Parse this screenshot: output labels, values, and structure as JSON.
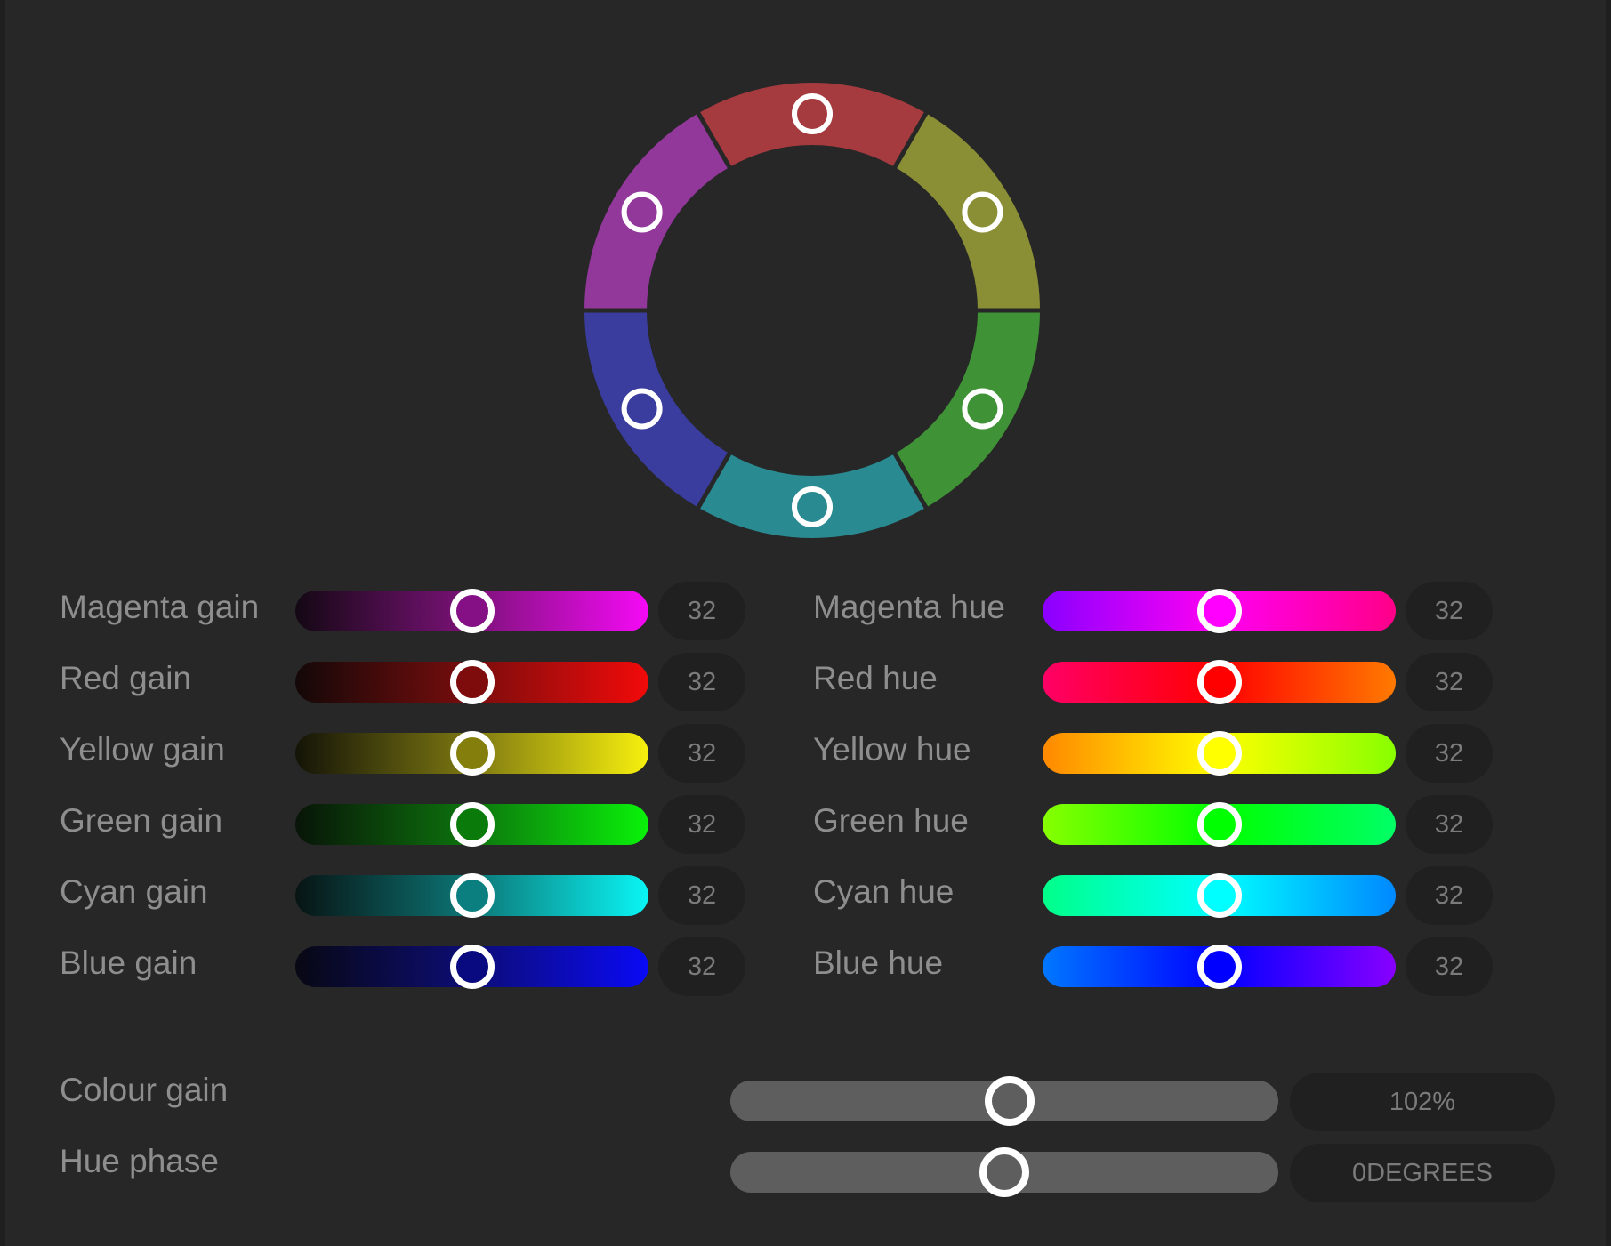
{
  "wheel": {
    "segments": [
      {
        "name": "red",
        "color": "#a53a3f",
        "mid_angle": 0
      },
      {
        "name": "yellow",
        "color": "#8a8e34",
        "mid_angle": 60
      },
      {
        "name": "green",
        "color": "#3f9236",
        "mid_angle": 120
      },
      {
        "name": "cyan",
        "color": "#2a8a92",
        "mid_angle": 180
      },
      {
        "name": "blue",
        "color": "#3a3c9e",
        "mid_angle": 240
      },
      {
        "name": "magenta",
        "color": "#92389a",
        "mid_angle": 300
      }
    ]
  },
  "gains": [
    {
      "id": "magenta",
      "label": "Magenta gain",
      "value": "32",
      "fraction": 0.5,
      "from": "#140814",
      "mid": "#7d127a",
      "to": "#f50af5",
      "thumb": "#850f85"
    },
    {
      "id": "red",
      "label": "Red gain",
      "value": "32",
      "fraction": 0.5,
      "from": "#140808",
      "mid": "#7a0d0d",
      "to": "#f20a0a",
      "thumb": "#7f0c0c"
    },
    {
      "id": "yellow",
      "label": "Yellow gain",
      "value": "32",
      "fraction": 0.5,
      "from": "#141408",
      "mid": "#7d7812",
      "to": "#f7f00e",
      "thumb": "#847f0c"
    },
    {
      "id": "green",
      "label": "Green gain",
      "value": "32",
      "fraction": 0.5,
      "from": "#081408",
      "mid": "#0d740d",
      "to": "#0af20a",
      "thumb": "#0a7a0a"
    },
    {
      "id": "cyan",
      "label": "Cyan gain",
      "value": "32",
      "fraction": 0.5,
      "from": "#081414",
      "mid": "#0d7676",
      "to": "#0af5f5",
      "thumb": "#0b7f80"
    },
    {
      "id": "blue",
      "label": "Blue gain",
      "value": "32",
      "fraction": 0.5,
      "from": "#080814",
      "mid": "#0d0d76",
      "to": "#0a0af5",
      "thumb": "#0a0a80"
    }
  ],
  "hues": [
    {
      "id": "magenta",
      "label": "Magenta hue",
      "value": "32",
      "fraction": 0.5,
      "from": "#8a00ff",
      "mid": "#ff00f2",
      "to": "#ff0088",
      "thumb": "#ff00ff"
    },
    {
      "id": "red",
      "label": "Red hue",
      "value": "32",
      "fraction": 0.5,
      "from": "#ff0066",
      "mid": "#ff0000",
      "to": "#ff7a00",
      "thumb": "#ff0000"
    },
    {
      "id": "yellow",
      "label": "Yellow hue",
      "value": "32",
      "fraction": 0.5,
      "from": "#ff8800",
      "mid": "#ffff00",
      "to": "#88ff00",
      "thumb": "#ffff00"
    },
    {
      "id": "green",
      "label": "Green hue",
      "value": "32",
      "fraction": 0.5,
      "from": "#88ff00",
      "mid": "#00ff00",
      "to": "#00ff66",
      "thumb": "#00ff00"
    },
    {
      "id": "cyan",
      "label": "Cyan hue",
      "value": "32",
      "fraction": 0.5,
      "from": "#00ff88",
      "mid": "#00ffff",
      "to": "#0088ff",
      "thumb": "#00ffff"
    },
    {
      "id": "blue",
      "label": "Blue hue",
      "value": "32",
      "fraction": 0.5,
      "from": "#0077ff",
      "mid": "#0000ff",
      "to": "#8800ff",
      "thumb": "#0000ff"
    }
  ],
  "colour_gain": {
    "label": "Colour gain",
    "value": "102%",
    "fraction": 0.51
  },
  "hue_phase": {
    "label": "Hue phase",
    "value": "0DEGREES",
    "fraction": 0.5
  }
}
